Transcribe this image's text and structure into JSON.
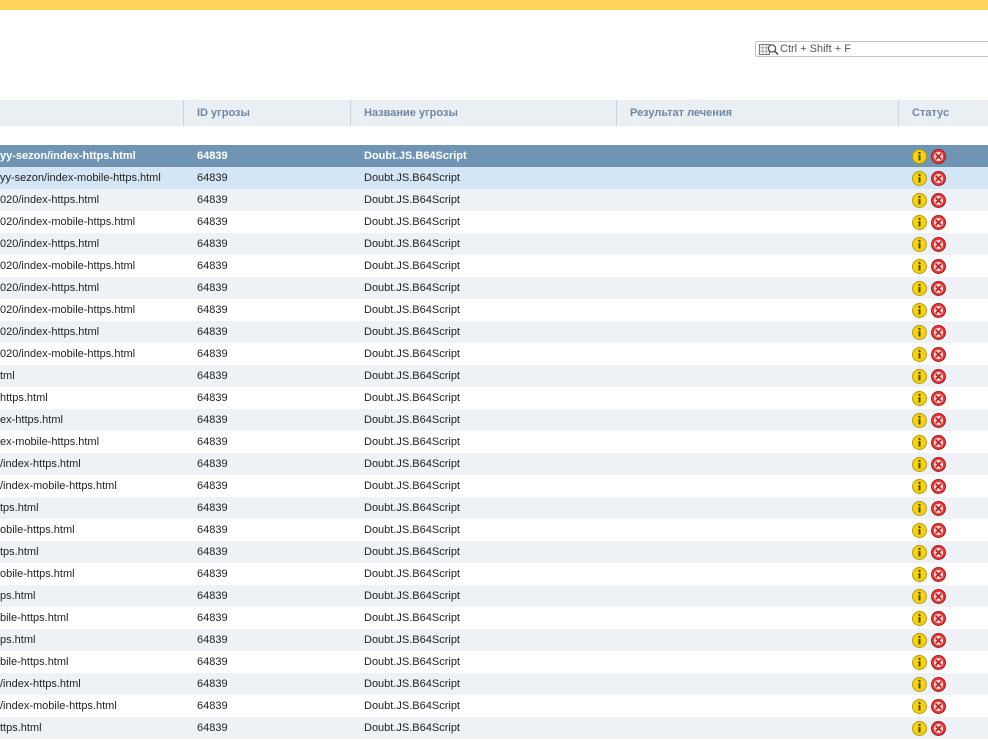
{
  "search": {
    "placeholder": "Ctrl + Shift + F"
  },
  "table": {
    "columns": [
      {
        "label": ""
      },
      {
        "label": "ID угрозы"
      },
      {
        "label": "Название угрозы"
      },
      {
        "label": "Результат лечения"
      },
      {
        "label": "Статус"
      }
    ],
    "rows": [
      {
        "path": "yy-sezon/index-https.html",
        "id": "64839",
        "name": "Doubt.JS.B64Script",
        "result": ""
      },
      {
        "path": "yy-sezon/index-mobile-https.html",
        "id": "64839",
        "name": "Doubt.JS.B64Script",
        "result": ""
      },
      {
        "path": "020/index-https.html",
        "id": "64839",
        "name": "Doubt.JS.B64Script",
        "result": ""
      },
      {
        "path": "020/index-mobile-https.html",
        "id": "64839",
        "name": "Doubt.JS.B64Script",
        "result": ""
      },
      {
        "path": "020/index-https.html",
        "id": "64839",
        "name": "Doubt.JS.B64Script",
        "result": ""
      },
      {
        "path": "020/index-mobile-https.html",
        "id": "64839",
        "name": "Doubt.JS.B64Script",
        "result": ""
      },
      {
        "path": "020/index-https.html",
        "id": "64839",
        "name": "Doubt.JS.B64Script",
        "result": ""
      },
      {
        "path": "020/index-mobile-https.html",
        "id": "64839",
        "name": "Doubt.JS.B64Script",
        "result": ""
      },
      {
        "path": "020/index-https.html",
        "id": "64839",
        "name": "Doubt.JS.B64Script",
        "result": ""
      },
      {
        "path": "020/index-mobile-https.html",
        "id": "64839",
        "name": "Doubt.JS.B64Script",
        "result": ""
      },
      {
        "path": "tml",
        "id": "64839",
        "name": "Doubt.JS.B64Script",
        "result": ""
      },
      {
        "path": "https.html",
        "id": "64839",
        "name": "Doubt.JS.B64Script",
        "result": ""
      },
      {
        "path": "ex-https.html",
        "id": "64839",
        "name": "Doubt.JS.B64Script",
        "result": ""
      },
      {
        "path": "ex-mobile-https.html",
        "id": "64839",
        "name": "Doubt.JS.B64Script",
        "result": ""
      },
      {
        "path": "/index-https.html",
        "id": "64839",
        "name": "Doubt.JS.B64Script",
        "result": ""
      },
      {
        "path": "/index-mobile-https.html",
        "id": "64839",
        "name": "Doubt.JS.B64Script",
        "result": ""
      },
      {
        "path": "tps.html",
        "id": "64839",
        "name": "Doubt.JS.B64Script",
        "result": ""
      },
      {
        "path": "obile-https.html",
        "id": "64839",
        "name": "Doubt.JS.B64Script",
        "result": ""
      },
      {
        "path": "tps.html",
        "id": "64839",
        "name": "Doubt.JS.B64Script",
        "result": ""
      },
      {
        "path": "obile-https.html",
        "id": "64839",
        "name": "Doubt.JS.B64Script",
        "result": ""
      },
      {
        "path": "ps.html",
        "id": "64839",
        "name": "Doubt.JS.B64Script",
        "result": ""
      },
      {
        "path": "bile-https.html",
        "id": "64839",
        "name": "Doubt.JS.B64Script",
        "result": ""
      },
      {
        "path": "ps.html",
        "id": "64839",
        "name": "Doubt.JS.B64Script",
        "result": ""
      },
      {
        "path": "bile-https.html",
        "id": "64839",
        "name": "Doubt.JS.B64Script",
        "result": ""
      },
      {
        "path": "/index-https.html",
        "id": "64839",
        "name": "Doubt.JS.B64Script",
        "result": ""
      },
      {
        "path": "/index-mobile-https.html",
        "id": "64839",
        "name": "Doubt.JS.B64Script",
        "result": ""
      },
      {
        "path": "ttps.html",
        "id": "64839",
        "name": "Doubt.JS.B64Script",
        "result": ""
      }
    ],
    "selected_row": 0,
    "hovered_row": 1
  },
  "icons": {
    "search": "search-icon",
    "info": "info-icon",
    "delete": "delete-icon"
  },
  "colors": {
    "top_bar": "#ffd45a",
    "header_bg": "#eaeff4",
    "header_text": "#6e89a1",
    "selected_row": "#7094b3",
    "hovered_row": "#d4e6f6",
    "alt_row": "#eef2f6",
    "info_icon": "#f2d21a",
    "delete_icon": "#e03b3b"
  }
}
